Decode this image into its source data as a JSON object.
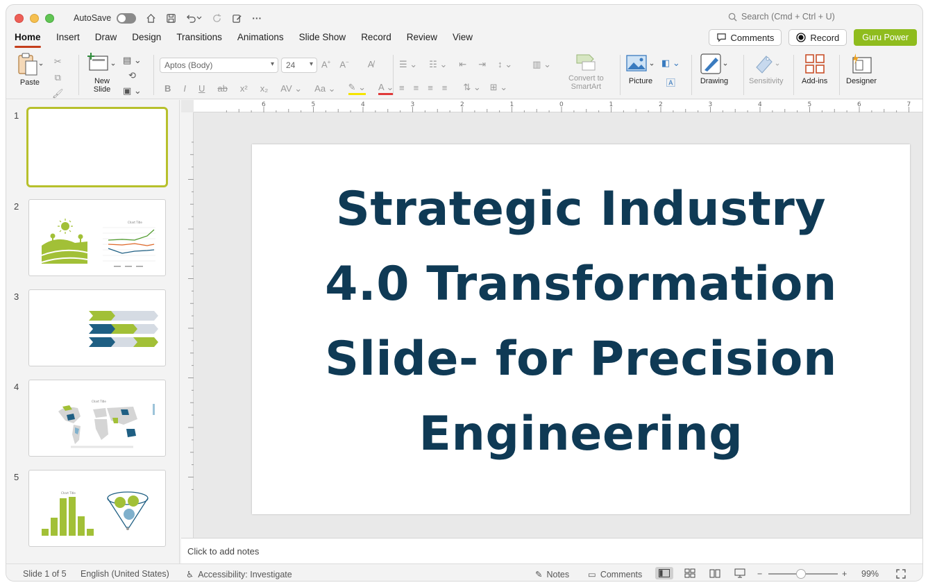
{
  "titlebar": {
    "autosave_label": "AutoSave",
    "search_placeholder": "Search (Cmd + Ctrl + U)"
  },
  "tabs": [
    "Home",
    "Insert",
    "Draw",
    "Design",
    "Transitions",
    "Animations",
    "Slide Show",
    "Record",
    "Review",
    "View"
  ],
  "top_buttons": {
    "comments": "Comments",
    "record": "Record",
    "addon": "Guru Power"
  },
  "ribbon": {
    "paste": "Paste",
    "new_slide": "New\nSlide",
    "font_name": "Aptos (Body)",
    "font_size": "24",
    "convert_smartart": "Convert to\nSmartArt",
    "picture": "Picture",
    "drawing": "Drawing",
    "sensitivity": "Sensitivity",
    "addins": "Add-ins",
    "designer": "Designer"
  },
  "thumbnails": [
    {
      "num": "1"
    },
    {
      "num": "2",
      "chart_title": "Chart Title"
    },
    {
      "num": "3"
    },
    {
      "num": "4",
      "chart_title": "Chart Title"
    },
    {
      "num": "5",
      "chart_title": "Chart Title"
    }
  ],
  "slide": {
    "title_lines": [
      "Strategic Industry",
      "4.0 Transformation",
      "Slide- for Precision",
      "Engineering"
    ]
  },
  "notes_placeholder": "Click to add notes",
  "status": {
    "slide_counter": "Slide 1 of 5",
    "language": "English (United States)",
    "accessibility": "Accessibility: Investigate",
    "notes": "Notes",
    "comments": "Comments",
    "zoom": "99%"
  },
  "colors": {
    "accent_tab": "#c43e1c",
    "title_text": "#0f3a55",
    "green": "#a2c037",
    "navy": "#1f5f83"
  }
}
